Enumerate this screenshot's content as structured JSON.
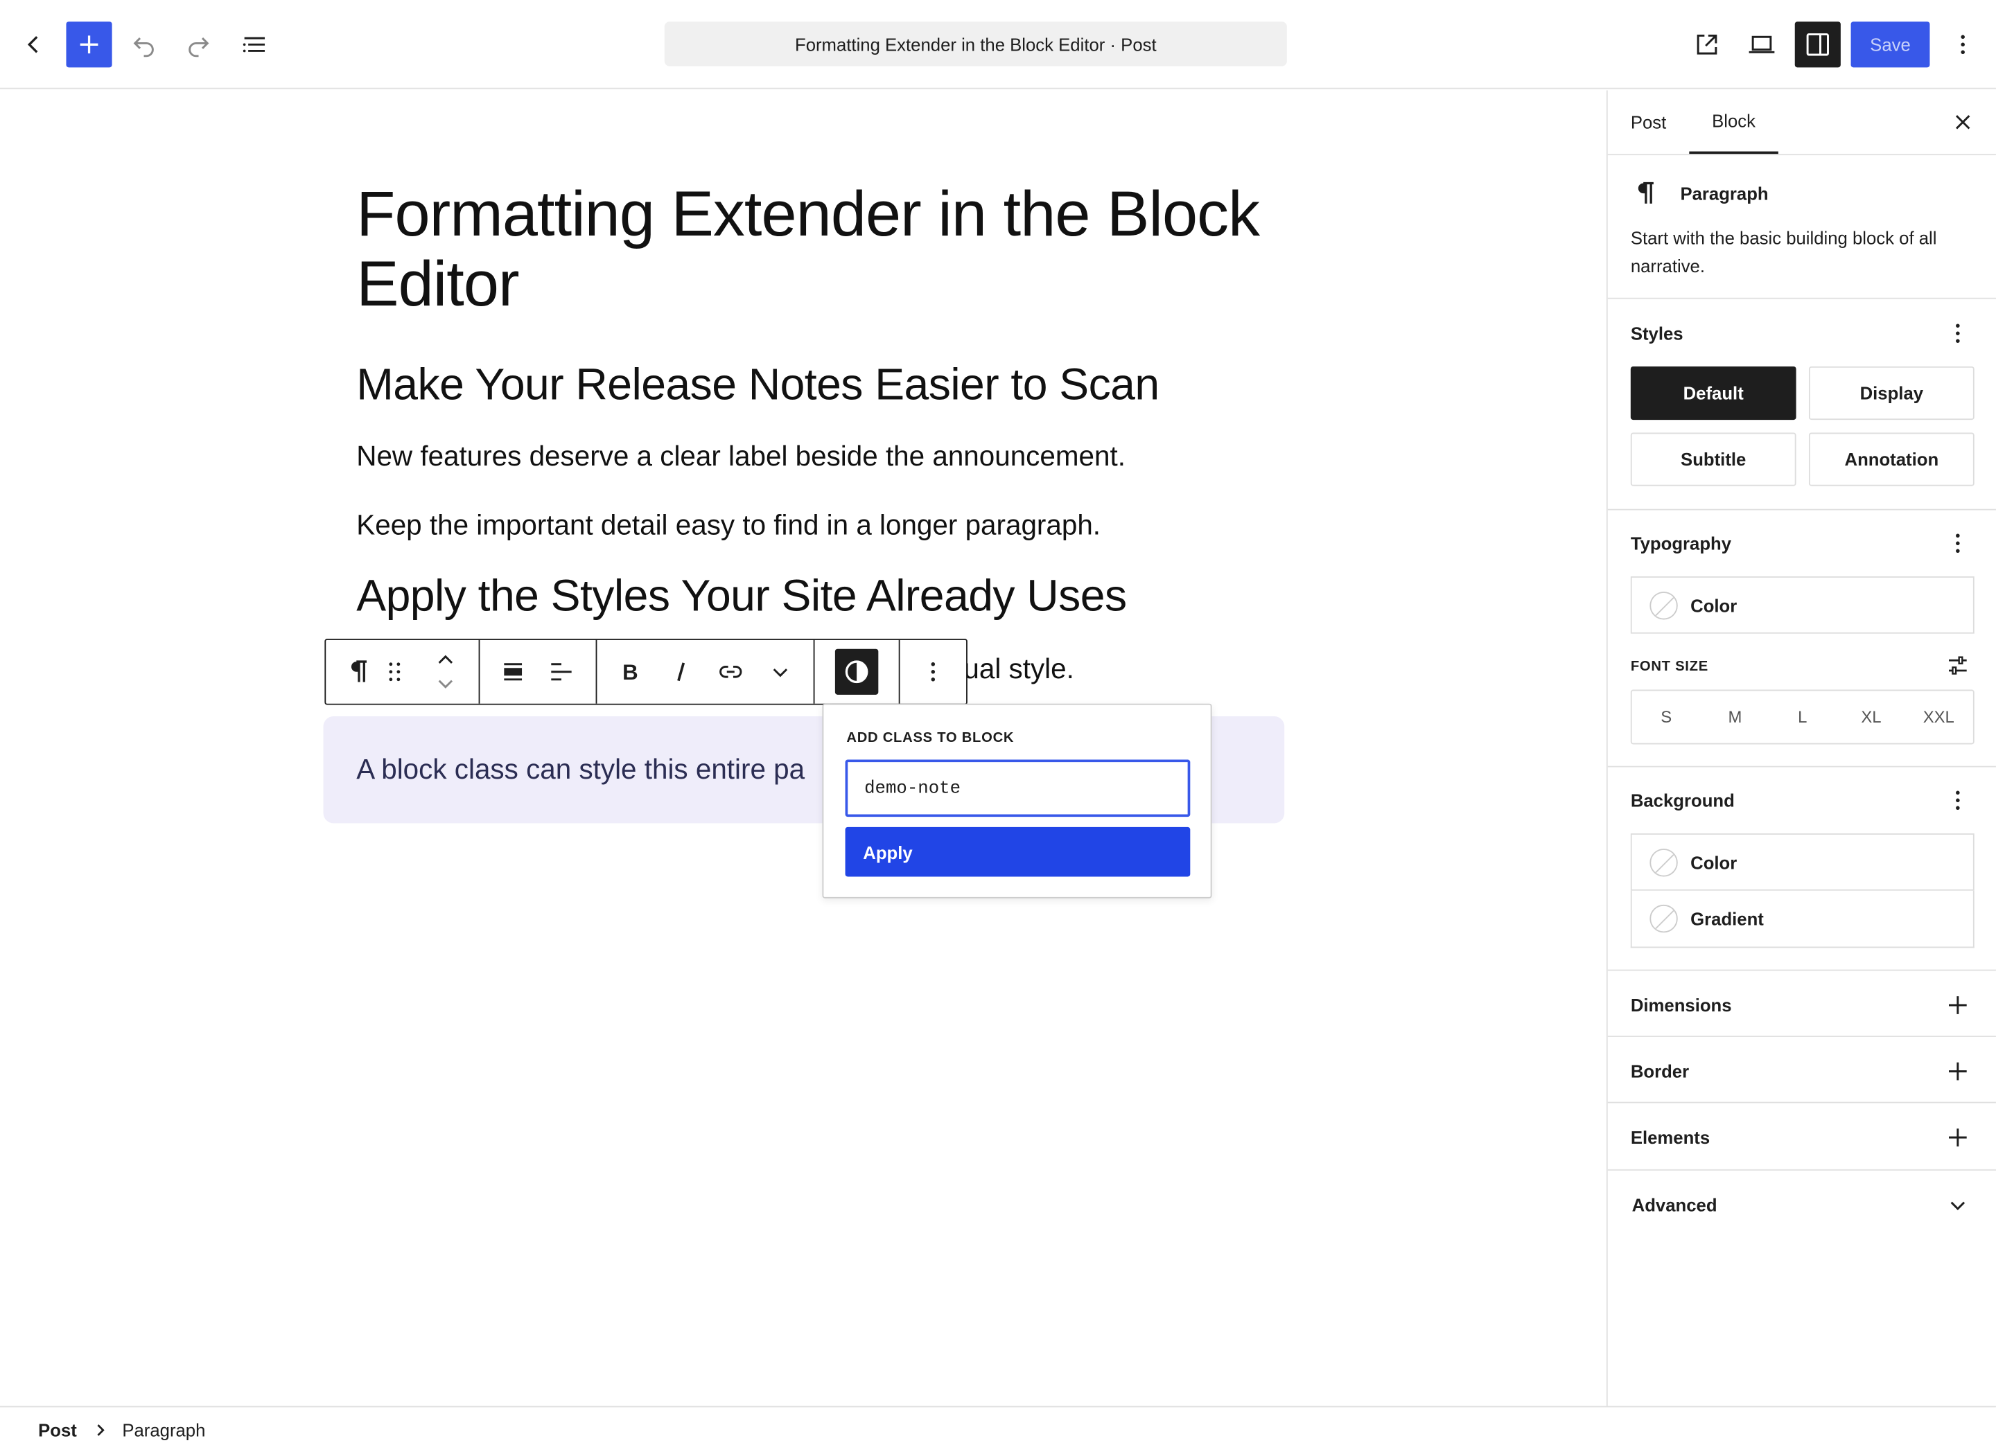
{
  "topbar": {
    "document_title": "Formatting Extender in the Block Editor · Post",
    "save_label": "Save",
    "accent_color": "#3858e9"
  },
  "content": {
    "post_title": "Formatting Extender in the Block Editor",
    "heading_1": "Make Your Release Notes Easier to Scan",
    "paragraph_1": "New features deserve a clear label beside the announcement.",
    "paragraph_2": "Keep the important detail easy to find in a longer paragraph.",
    "heading_2": "Apply the Styles Your Site Already Uses",
    "paragraph_3_visible": "ual style.",
    "callout_text": "A block class can style this entire pa"
  },
  "popover": {
    "label": "ADD CLASS TO BLOCK",
    "input_value": "demo-note",
    "apply_label": "Apply"
  },
  "sidebar": {
    "tabs": [
      "Post",
      "Block"
    ],
    "active_tab": "Block",
    "block_name": "Paragraph",
    "block_description_line1": "Start with the basic building block of all",
    "block_description_line2": "narrative.",
    "styles": {
      "heading": "Styles",
      "options": [
        "Default",
        "Display",
        "Subtitle",
        "Annotation"
      ],
      "selected": "Default"
    },
    "typography": {
      "heading": "Typography",
      "color_label": "Color",
      "font_size_label": "FONT SIZE",
      "sizes": [
        "S",
        "M",
        "L",
        "XL",
        "XXL"
      ]
    },
    "background": {
      "heading": "Background",
      "color_label": "Color",
      "gradient_label": "Gradient"
    },
    "panels": {
      "dimensions": "Dimensions",
      "border": "Border",
      "elements": "Elements",
      "advanced": "Advanced"
    }
  },
  "breadcrumb": {
    "root": "Post",
    "current": "Paragraph"
  }
}
